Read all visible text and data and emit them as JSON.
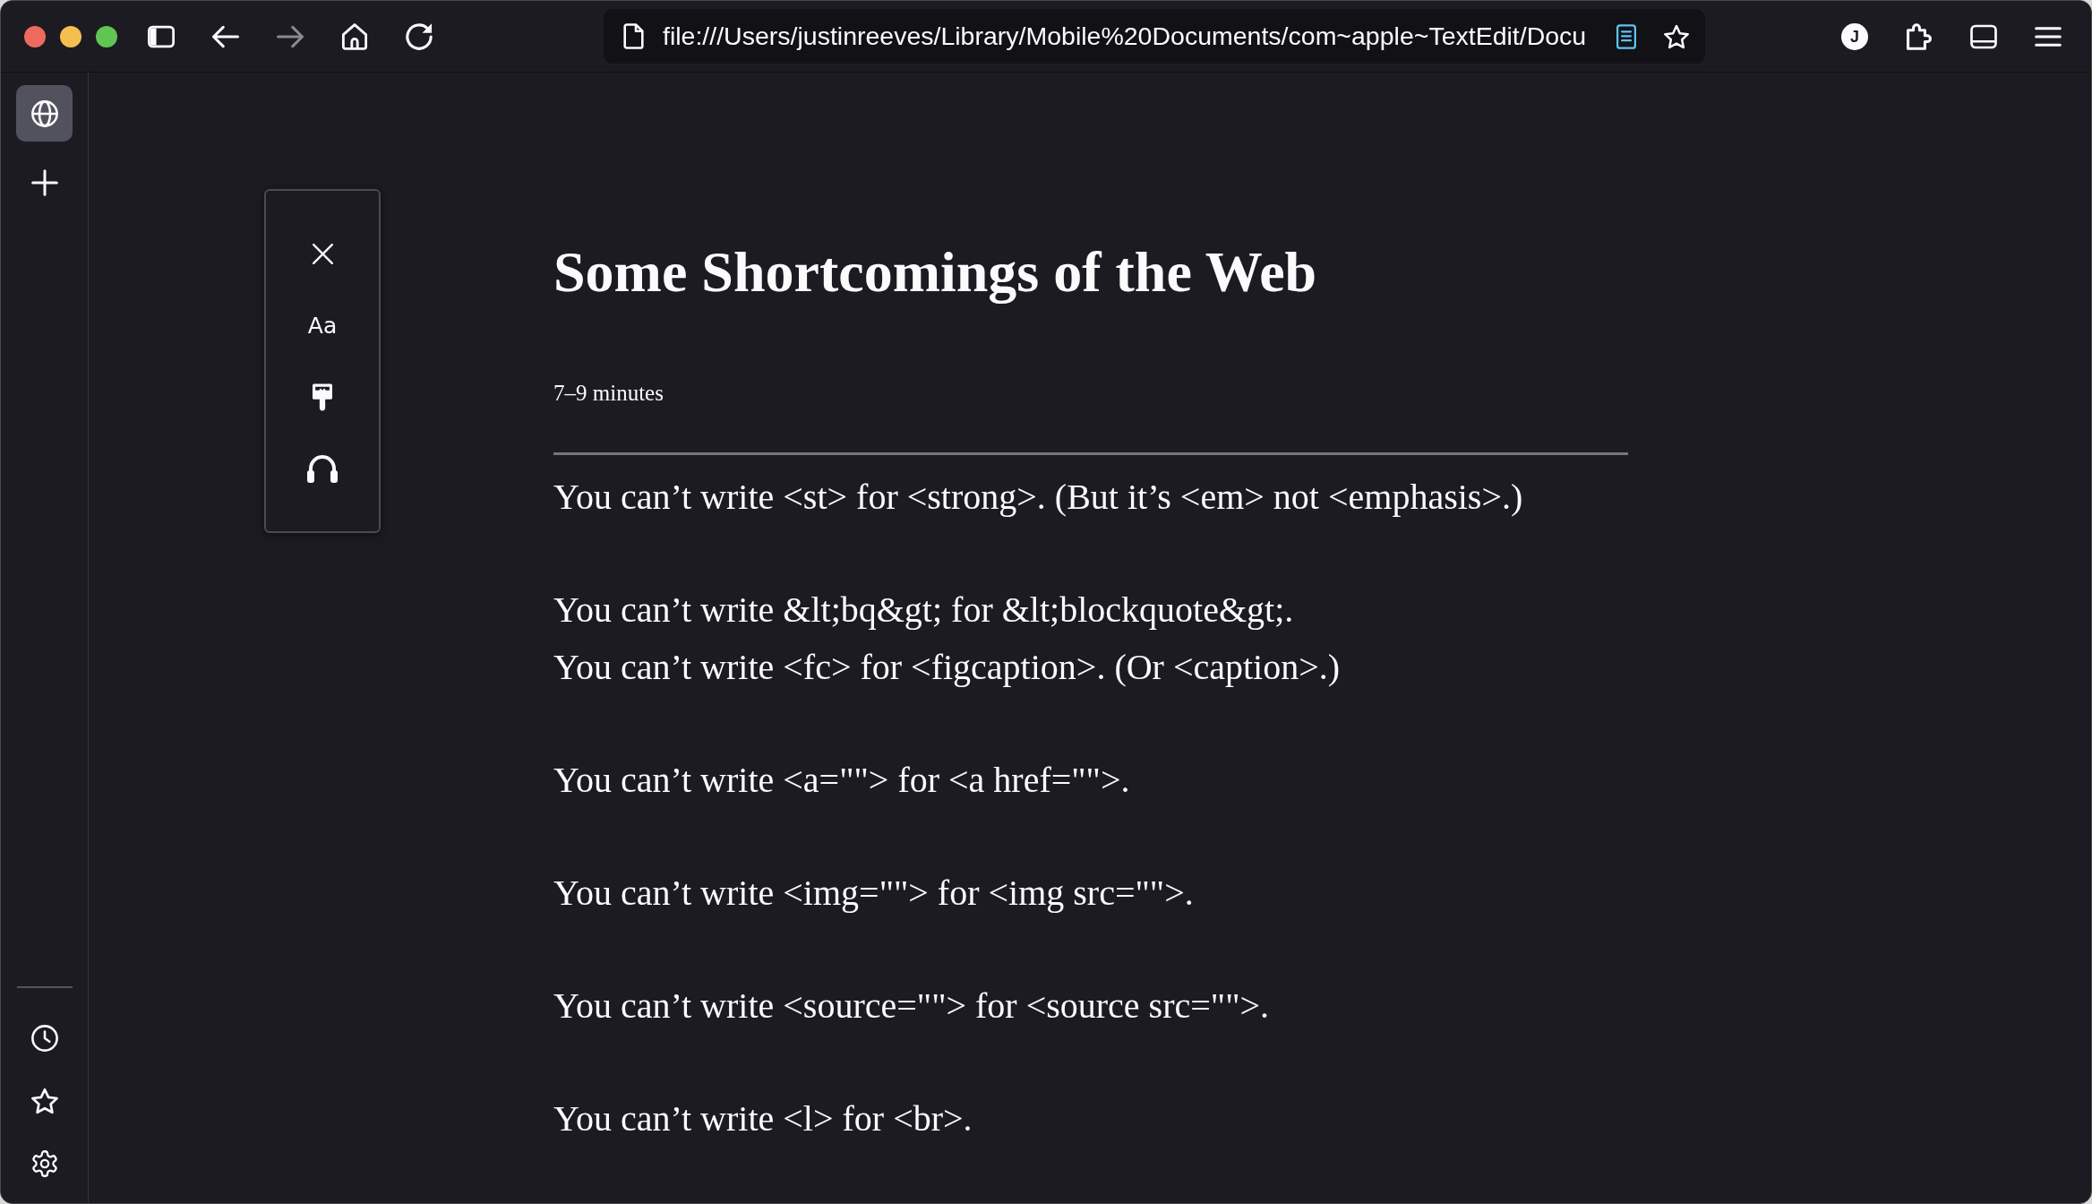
{
  "toolbar": {
    "nav_buttons": [
      {
        "kind": "sidebar",
        "disabled": false
      },
      {
        "kind": "back",
        "disabled": false
      },
      {
        "kind": "forward",
        "disabled": true
      },
      {
        "kind": "home",
        "disabled": false
      },
      {
        "kind": "reload",
        "disabled": false
      }
    ],
    "address_bar": {
      "url": "file:///Users/justinreeves/Library/Mobile%20Documents/com~apple~TextEdit/Docu",
      "reader_mode_on": true
    },
    "account": {
      "initial": "J"
    }
  },
  "sidebar": {
    "items": [
      {
        "kind": "globe",
        "selected": true
      },
      {
        "kind": "add",
        "selected": false
      }
    ],
    "footer_items": [
      {
        "kind": "history",
        "selected": false
      },
      {
        "kind": "bookmarks",
        "selected": false
      },
      {
        "kind": "settings",
        "selected": false
      }
    ]
  },
  "reader_toolbar": {
    "buttons": [
      {
        "kind": "close"
      },
      {
        "kind": "text_settings",
        "label": "Aa"
      },
      {
        "kind": "theme"
      },
      {
        "kind": "narrate"
      }
    ]
  },
  "article": {
    "title": "Some Shortcomings of the Web",
    "reading_time": "7–9 minutes",
    "paragraphs": [
      {
        "lines": [
          "You can’t write <st> for <strong>. (But it’s <em> not <emphasis>.)"
        ]
      },
      {
        "lines": [
          "You can’t write &lt;bq&gt; for &lt;blockquote&gt;.",
          "You can’t write <fc> for <figcaption>. (Or <caption>.)"
        ]
      },
      {
        "lines": [
          "You can’t write <a=\"\"> for <a href=\"\">."
        ]
      },
      {
        "lines": [
          "You can’t write <img=\"\"> for <img src=\"\">."
        ]
      },
      {
        "lines": [
          "You can’t write <source=\"\"> for <source src=\"\">."
        ]
      },
      {
        "lines": [
          "You can’t write <l> for <br>."
        ]
      }
    ]
  }
}
